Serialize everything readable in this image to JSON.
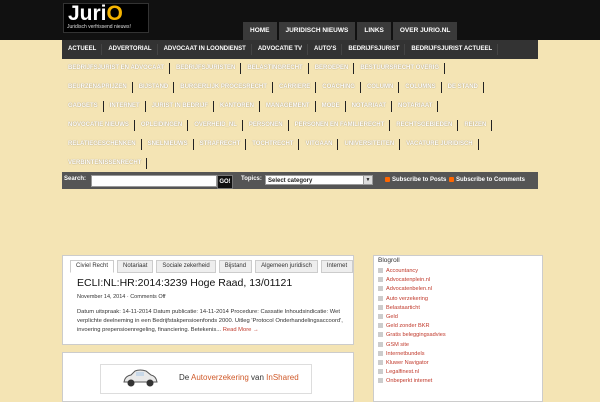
{
  "logo": {
    "name_prefix": "Juri",
    "name_suffix": "O",
    "tagline": "Juridisch verfrissend nieuws!"
  },
  "topnav": [
    "HOME",
    "JURIDISCH NIEUWS",
    "LINKS",
    "OVER JURIO.NL"
  ],
  "categories": [
    [
      "ACTUEEL",
      "ADVERTORIAL",
      "ADVOCAAT IN LOONDIENST",
      "ADVOCATIE TV",
      "AUTO'S",
      "BEDRIJFSJURIST",
      "BEDRIJFSJURIST ACTUEEL"
    ],
    [
      "BEDRIJFSJURIST EN ADVOCAAT",
      "BEDRIJFSJURISTEN",
      "BELASTINGRECHT",
      "BEROEPEN",
      "BESTUURSRECHT OVERIG"
    ],
    [
      "BEURZEN&PRIJZEN",
      "BIJSTAND",
      "BURGERLIJK PROCESRECHT",
      "CARRIERE",
      "COACHING",
      "COLUMN",
      "COLUMNS",
      "DE STAND"
    ],
    [
      "GADGETS",
      "INTERNET",
      "JURIST IN BEDRIJF",
      "KANTOREN",
      "MANAGEMENT",
      "MODE",
      "NOTARIAAT",
      "NOTARIAAT"
    ],
    [
      "NOVOCATIE NIEUWS",
      "OPLEIDINGEN",
      "OVERHEID_NL",
      "PERSONEN",
      "PERSONEN EN FAMILIERECHT",
      "RECHTSGEBIEDEN",
      "REIZEN"
    ],
    [
      "RELATIEGESCHENKEN",
      "SNELNIEUWS",
      "STRAFRECHT",
      "TOCHTRECHT",
      "VITGAAN",
      "UNIVERSITEITEN",
      "VACATURE JURIDISCH"
    ],
    [
      "VERBINTENISSENRECHT"
    ]
  ],
  "search": {
    "label": "Search:",
    "go": "GO!",
    "topics_label": "Topics:",
    "selected_topic": "Select category"
  },
  "rss": {
    "posts": "Subscribe to Posts",
    "comments": "Subscribe to Comments"
  },
  "tabs": [
    "Civiel Recht",
    "Notariaat",
    "Sociale zekerheid",
    "Bijstand",
    "Algemeen juridisch",
    "Internet"
  ],
  "post": {
    "title": "ECLI:NL:HR:2014:3239 Hoge Raad, 13/01121",
    "date": "November 14, 2014",
    "comments": "Comments Off",
    "excerpt": "Datum uitspraak: 14-11-2014 Datum publicatie: 14-11-2014 Procedure: Cassatie Inhoudsindicatie: Wet verplichte deelneming in een Bedrijfstakpensioenfonds 2000. Uitleg 'Protocol Onderhandelingsaccoord', invoering prepensioenregeling, financiering. Betekenis...",
    "read_more": "Read More →"
  },
  "ad": {
    "prefix": "De ",
    "main": "Autoverzekering",
    "mid": " van ",
    "brand": "InShared"
  },
  "blogroll": {
    "title": "Blogroll",
    "items": [
      "Accountancy",
      "Advocatenplein.nl",
      "Advocatenbelen.nl",
      "Auto verzekering",
      "Belastaarticht",
      "Geld",
      "Geld zonder BKR",
      "Gratis beleggingsadvies",
      "GSM site",
      "Internetbundels",
      "Kluwer Navigator",
      "Legalfinest.nl",
      "Onbeperkt internet"
    ]
  },
  "colors": {
    "header_bg": "#111111",
    "body_bg": "#f4e4b4",
    "accent": "#f5b400",
    "link": "#c0392b"
  }
}
